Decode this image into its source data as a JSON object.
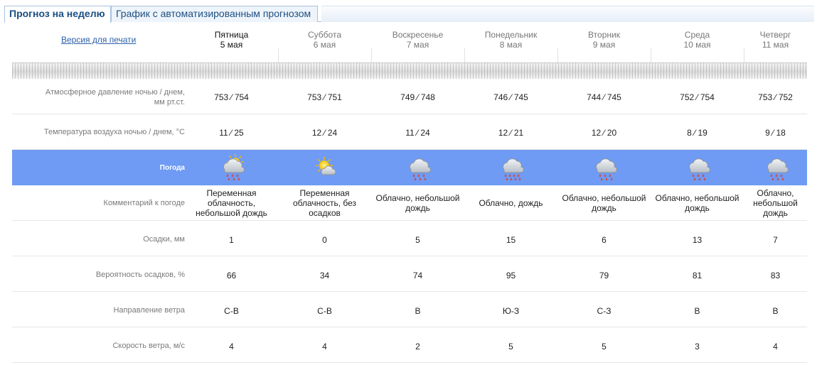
{
  "tabs": [
    {
      "label": "Прогноз на неделю",
      "active": true
    },
    {
      "label": "График с автоматизированным прогнозом",
      "active": false
    }
  ],
  "print_link": "Версия для печати",
  "days": [
    {
      "name": "Пятница",
      "date": "5 мая",
      "icon": "cloud-sun-rain-icon",
      "comment": [
        "Переменная",
        "облачность,",
        "небольшой дождь"
      ],
      "pressure": "753 ⁄ 754",
      "temp": "11 ⁄ 25",
      "precip": "1",
      "prob": "66",
      "wind_dir": "С-В",
      "wind_speed": "4"
    },
    {
      "name": "Суббота",
      "date": "6 мая",
      "icon": "sun-cloud-icon",
      "comment": [
        "Переменная",
        "облачность, без",
        "осадков"
      ],
      "pressure": "753 ⁄ 751",
      "temp": "12 ⁄ 24",
      "precip": "0",
      "prob": "34",
      "wind_dir": "С-В",
      "wind_speed": "4"
    },
    {
      "name": "Воскресенье",
      "date": "7 мая",
      "icon": "cloud-rain-icon",
      "comment": [
        "Облачно, небольшой",
        "дождь"
      ],
      "pressure": "749 ⁄ 748",
      "temp": "11 ⁄ 24",
      "precip": "5",
      "prob": "74",
      "wind_dir": "В",
      "wind_speed": "2"
    },
    {
      "name": "Понедельник",
      "date": "8 мая",
      "icon": "cloud-heavy-rain-icon",
      "comment": [
        "Облачно, дождь"
      ],
      "pressure": "746 ⁄ 745",
      "temp": "12 ⁄ 21",
      "precip": "15",
      "prob": "95",
      "wind_dir": "Ю-З",
      "wind_speed": "5"
    },
    {
      "name": "Вторник",
      "date": "9 мая",
      "icon": "cloud-rain-icon",
      "comment": [
        "Облачно, небольшой",
        "дождь"
      ],
      "pressure": "744 ⁄ 745",
      "temp": "12 ⁄ 20",
      "precip": "6",
      "prob": "79",
      "wind_dir": "С-З",
      "wind_speed": "5"
    },
    {
      "name": "Среда",
      "date": "10 мая",
      "icon": "cloud-rain-icon",
      "comment": [
        "Облачно, небольшой",
        "дождь"
      ],
      "pressure": "752 ⁄ 754",
      "temp": "8 ⁄ 19",
      "precip": "13",
      "prob": "81",
      "wind_dir": "В",
      "wind_speed": "3"
    },
    {
      "name": "Четверг",
      "date": "11 мая",
      "icon": "cloud-rain-icon",
      "comment": [
        "Облачно,",
        "небольшой",
        "дождь"
      ],
      "pressure": "753 ⁄ 752",
      "temp": "9 ⁄ 18",
      "precip": "7",
      "prob": "83",
      "wind_dir": "В",
      "wind_speed": "4"
    }
  ],
  "rows": {
    "pressure_label": [
      "Атмосферное давление ночью  /  днем,",
      "мм рт.ст."
    ],
    "temp_label": "Температура воздуха ночью  /  днем, °C",
    "weather_label": "Погода",
    "comment_label": "Комментарий к погоде",
    "precip_label": "Осадки, мм",
    "prob_label": "Вероятность осадков, %",
    "wind_dir_label": "Направление ветра",
    "wind_speed_label": "Скорость ветра, м/с"
  },
  "colors": {
    "weather_band": "#6f9bf5",
    "tab_border": "#a9c3dd",
    "link": "#2a5fa8"
  }
}
